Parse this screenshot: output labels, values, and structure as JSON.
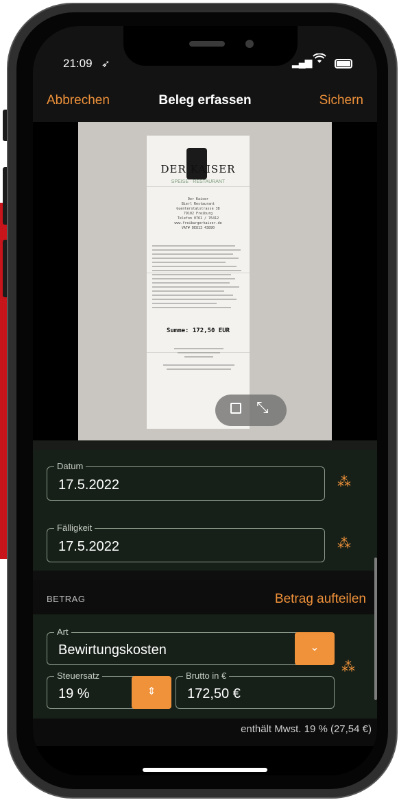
{
  "status_bar": {
    "time": "21:09",
    "location_icon": "location-arrow-icon",
    "signal_icon": "cellular-signal-icon",
    "wifi_icon": "wifi-icon",
    "battery_icon": "battery-icon"
  },
  "navbar": {
    "cancel": "Abbrechen",
    "title": "Beleg erfassen",
    "save": "Sichern"
  },
  "receipt": {
    "logo": "DER KAISER",
    "subtitle": "SPEISE · RESTAURANT",
    "address": "Der Kaiser\nBierl Restaurant\nGuenterstalstrasse 38\n79102 Freiburg\nTelefon 0761 / 76412\nwww.freiburgerkaiser.de\nVAT# DE813 43890",
    "total": "Summe: 172,50 EUR",
    "crop_icon": "crop-rotate-icon",
    "expand_icon": "expand-arrows-icon"
  },
  "form": {
    "datum": {
      "label": "Datum",
      "value": "17.5.2022"
    },
    "faelligkeit": {
      "label": "Fälligkeit",
      "value": "17.5.2022"
    },
    "wand_icon": "magic-wand-icon"
  },
  "betrag": {
    "header": "BETRAG",
    "split": "Betrag aufteilen",
    "art": {
      "label": "Art",
      "value": "Bewirtungskosten"
    },
    "steuersatz": {
      "label": "Steuersatz",
      "value": "19 %"
    },
    "brutto": {
      "label": "Brutto in €",
      "value": "172,50 €"
    },
    "mwst": "enthält Mwst. 19 % (27,54 €)"
  },
  "colors": {
    "accent": "#f0923a",
    "panel": "#162018",
    "side_accent": "#c8141b"
  }
}
